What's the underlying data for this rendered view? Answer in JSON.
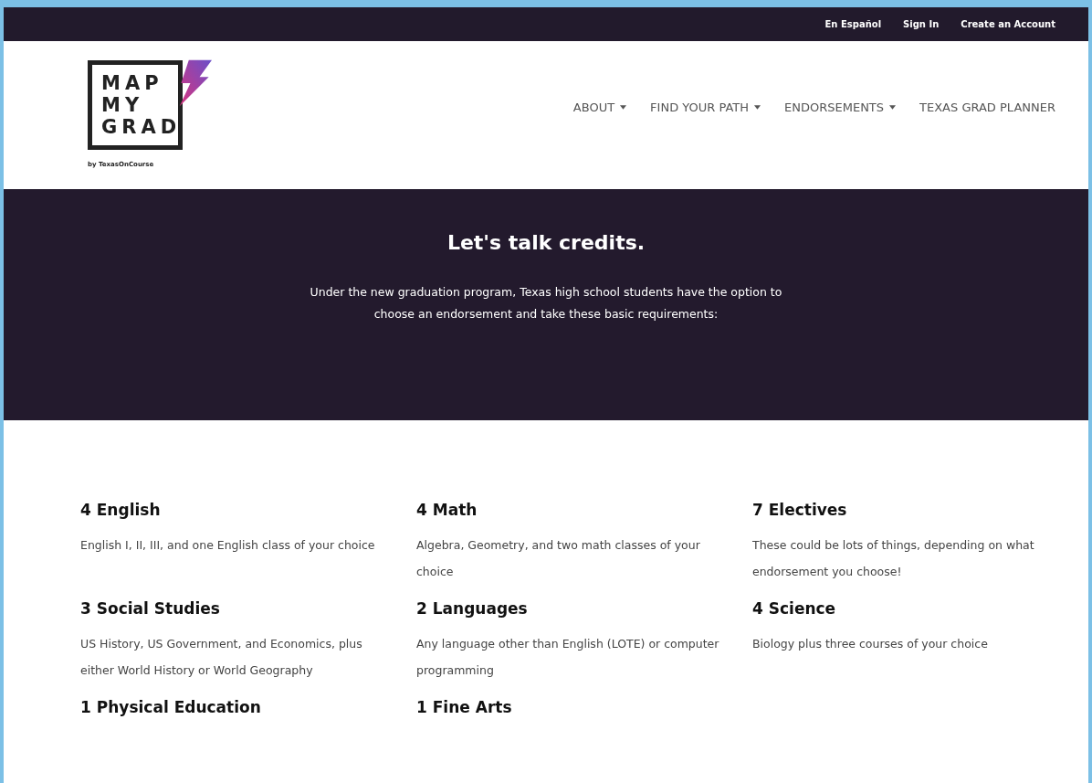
{
  "top_bar": {
    "links": [
      "En Español",
      "Sign In",
      "Create an Account"
    ]
  },
  "header": {
    "logo": {
      "lines": [
        "MAP",
        "MY",
        "GRAD"
      ],
      "byline": "by TexasOnCourse"
    },
    "nav": [
      {
        "label": "ABOUT",
        "dropdown": true
      },
      {
        "label": "FIND YOUR PATH",
        "dropdown": true
      },
      {
        "label": "ENDORSEMENTS",
        "dropdown": true
      },
      {
        "label": "TEXAS GRAD PLANNER",
        "dropdown": false
      }
    ]
  },
  "hero": {
    "title": "Let's talk credits.",
    "text": "Under the new graduation program, Texas high school students have the option to choose an endorsement and take these basic requirements:"
  },
  "requirements": [
    {
      "title": "4 English",
      "text": "English I, II, III, and one English class of your choice"
    },
    {
      "title": "4 Math",
      "text": "Algebra, Geometry, and two math classes of your choice"
    },
    {
      "title": "7 Electives",
      "text": "These could be lots of things, depending on what endorsement you choose!"
    },
    {
      "title": "3 Social Studies",
      "text": "US History, US Government, and Economics, plus either World History or World Geography"
    },
    {
      "title": "2 Languages",
      "text": "Any language other than English (LOTE) or computer programming"
    },
    {
      "title": "4 Science",
      "text": "Biology plus three courses of your choice"
    },
    {
      "title": "1 Physical Education"
    },
    {
      "title": "1 Fine Arts"
    }
  ]
}
